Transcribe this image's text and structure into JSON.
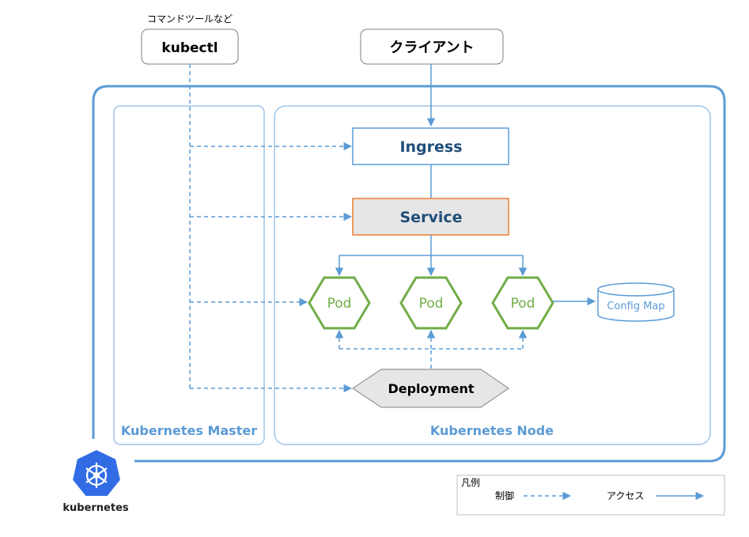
{
  "clients": {
    "tools_caption": "コマンドツールなど",
    "kubectl": "kubectl",
    "client": "クライアント"
  },
  "cluster": {
    "master_label": "Kubernetes Master",
    "node_label": "Kubernetes Node"
  },
  "components": {
    "ingress": "Ingress",
    "service": "Service",
    "pods": [
      "Pod",
      "Pod",
      "Pod"
    ],
    "config_map": "Config Map",
    "deployment": "Deployment"
  },
  "logo": {
    "text": "kubernetes"
  },
  "legend": {
    "title": "凡例",
    "control": "制御",
    "access": "アクセス"
  },
  "colors": {
    "cluster_border": "#5b9bd5",
    "inner_border": "#9dc3e6",
    "dark_blue": "#1f4e79",
    "accent_orange": "#ed7d31",
    "pod_green": "#70ad47",
    "service_fill": "#e7e6e6",
    "kubernetes_blue": "#326ce5"
  }
}
